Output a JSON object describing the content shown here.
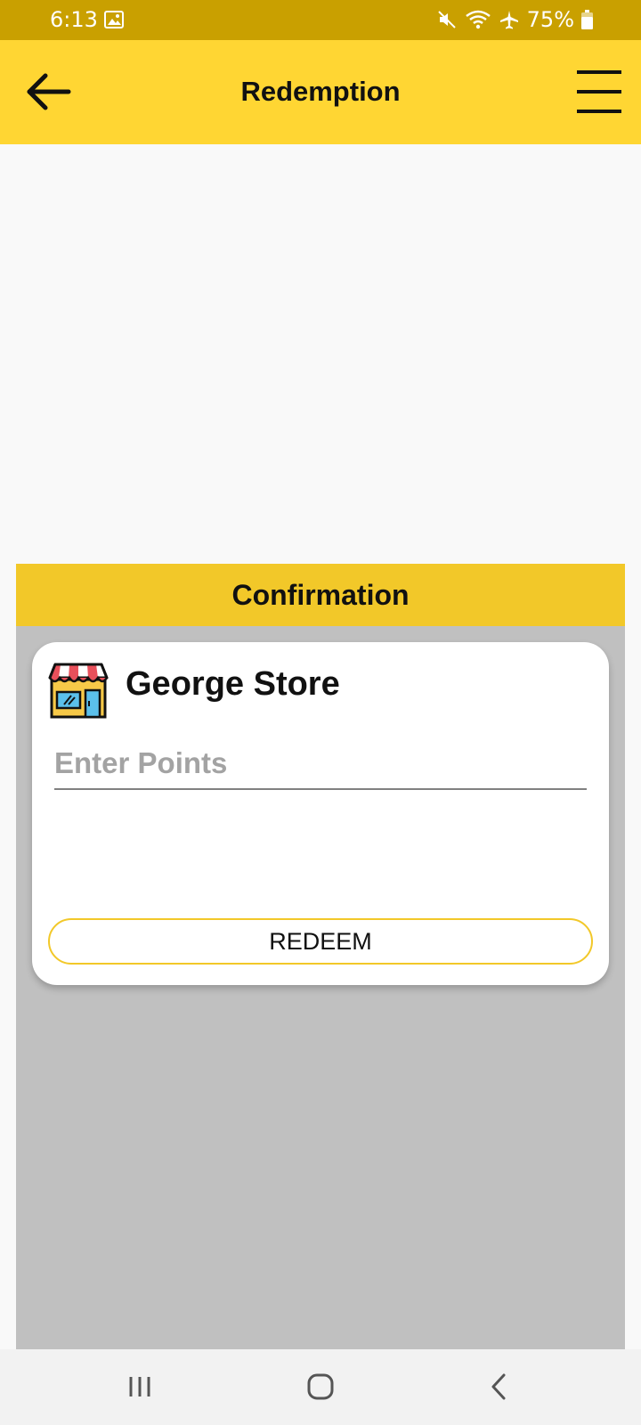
{
  "status_bar": {
    "time": "6:13",
    "battery": "75%",
    "icons": [
      "gallery-icon",
      "mute-icon",
      "wifi-icon",
      "airplane-icon",
      "battery-icon"
    ]
  },
  "app_bar": {
    "title": "Redemption",
    "back_icon": "arrow-left-icon",
    "menu_icon": "hamburger-menu-icon",
    "color": "#ffd633"
  },
  "dialog": {
    "title": "Confirmation",
    "header_color": "#f2c829",
    "store": {
      "name": "George Store",
      "icon": "store-icon"
    },
    "points_input": {
      "value": "",
      "placeholder": "Enter Points"
    },
    "redeem_label": "REDEEM"
  },
  "nav_bar": {
    "buttons": [
      "recent-apps-icon",
      "home-icon",
      "back-icon"
    ]
  }
}
